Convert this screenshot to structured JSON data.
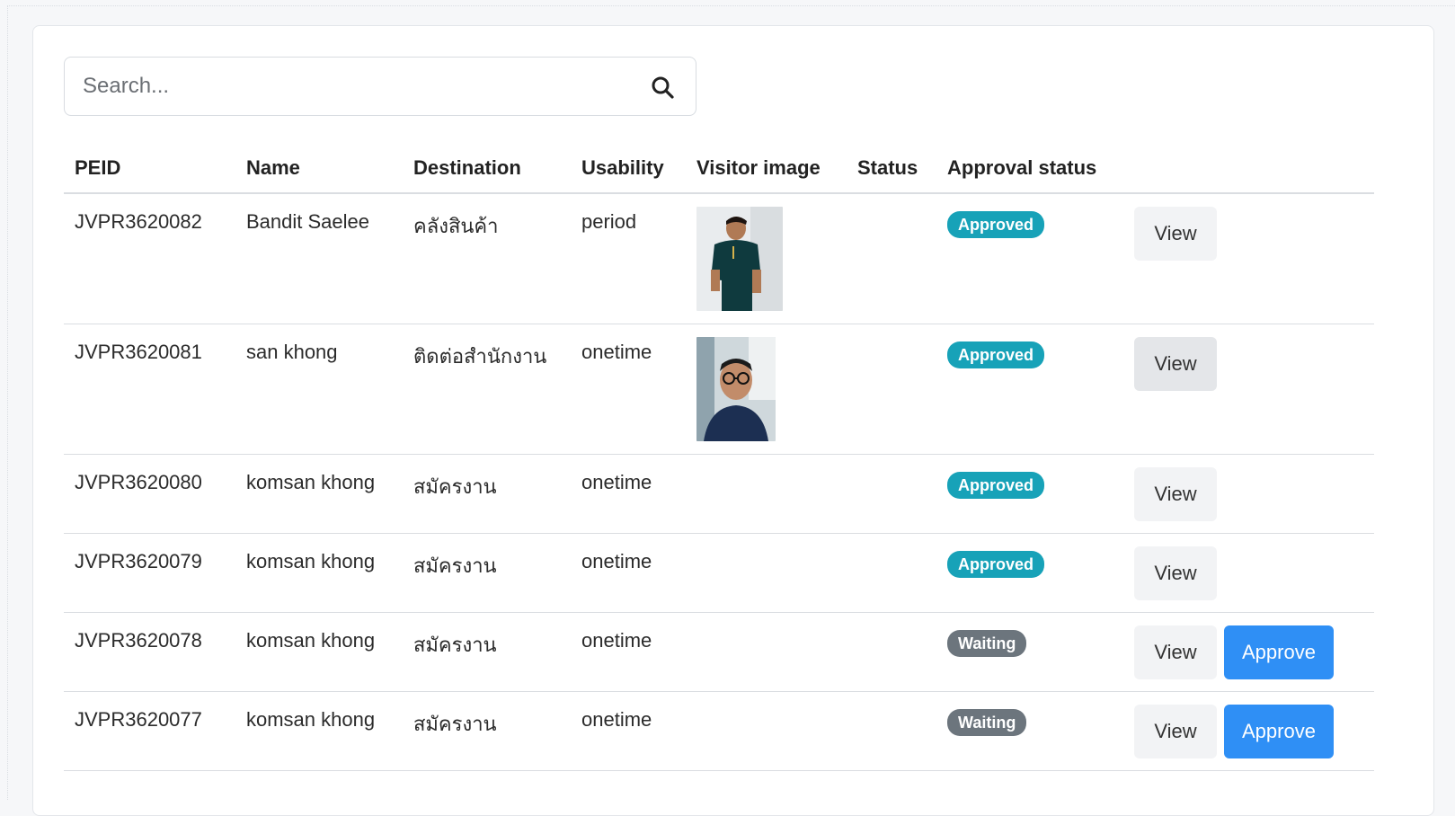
{
  "search": {
    "placeholder": "Search..."
  },
  "columns": [
    "PEID",
    "Name",
    "Destination",
    "Usability",
    "Visitor image",
    "Status",
    "Approval status"
  ],
  "rows": [
    {
      "peid": "JVPR3620082",
      "name": "Bandit Saelee",
      "destination": "คลังสินค้า",
      "usability": "period",
      "image": "visitor-photo-green-shirt",
      "status": "",
      "approval": "Approved",
      "view_label": "View",
      "approve_label": ""
    },
    {
      "peid": "JVPR3620081",
      "name": "san khong",
      "destination": "ติดต่อสำนักงาน",
      "usability": "onetime",
      "image": "visitor-photo-glasses-selfie",
      "status": "",
      "approval": "Approved",
      "view_label": "View",
      "approve_label": ""
    },
    {
      "peid": "JVPR3620080",
      "name": "komsan khong",
      "destination": "สมัครงาน",
      "usability": "onetime",
      "image": "",
      "status": "",
      "approval": "Approved",
      "view_label": "View",
      "approve_label": ""
    },
    {
      "peid": "JVPR3620079",
      "name": "komsan khong",
      "destination": "สมัครงาน",
      "usability": "onetime",
      "image": "",
      "status": "",
      "approval": "Approved",
      "view_label": "View",
      "approve_label": ""
    },
    {
      "peid": "JVPR3620078",
      "name": "komsan khong",
      "destination": "สมัครงาน",
      "usability": "onetime",
      "image": "",
      "status": "",
      "approval": "Waiting",
      "view_label": "View",
      "approve_label": "Approve"
    },
    {
      "peid": "JVPR3620077",
      "name": "komsan khong",
      "destination": "สมัครงาน",
      "usability": "onetime",
      "image": "",
      "status": "",
      "approval": "Waiting",
      "view_label": "View",
      "approve_label": "Approve"
    }
  ],
  "colors": {
    "approved_badge": "#17a2b8",
    "waiting_badge": "#6c757d",
    "approve_button": "#2f8ff5"
  },
  "icons": {
    "search": "search-icon"
  }
}
